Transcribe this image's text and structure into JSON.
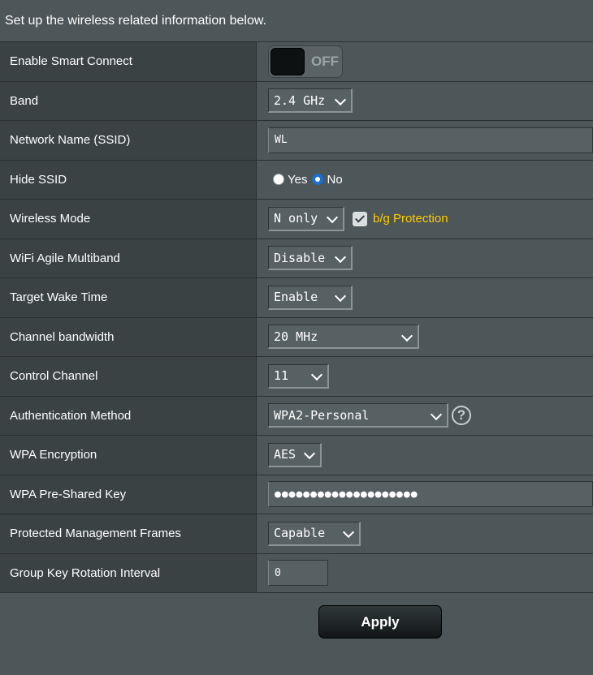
{
  "intro": "Set up the wireless related information below.",
  "colors": {
    "accent_blue": "#1a6fd0",
    "protection_yellow": "#ffcc00",
    "panel": "#4d5659",
    "label_bg": "#3a4244"
  },
  "rows": {
    "smart_connect": {
      "label": "Enable Smart Connect",
      "state": "OFF"
    },
    "band": {
      "label": "Band",
      "value": "2.4 GHz"
    },
    "ssid": {
      "label": "Network Name (SSID)",
      "value": "WL"
    },
    "hide_ssid": {
      "label": "Hide SSID",
      "yes": "Yes",
      "no": "No",
      "selected": "No"
    },
    "wireless_mode": {
      "label": "Wireless Mode",
      "value": "N only",
      "protection_label": "b/g Protection",
      "protection_checked": true
    },
    "agile_multiband": {
      "label": "WiFi Agile Multiband",
      "value": "Disable"
    },
    "target_wake_time": {
      "label": "Target Wake Time",
      "value": "Enable"
    },
    "channel_bandwidth": {
      "label": "Channel bandwidth",
      "value": "20 MHz"
    },
    "control_channel": {
      "label": "Control Channel",
      "value": "11"
    },
    "auth_method": {
      "label": "Authentication Method",
      "value": "WPA2-Personal",
      "help_icon": "help-icon",
      "help_glyph": "?"
    },
    "wpa_encryption": {
      "label": "WPA Encryption",
      "value": "AES"
    },
    "psk": {
      "label": "WPA Pre-Shared Key",
      "value": "●●●●●●●●●●●●●●●●●●●●"
    },
    "pmf": {
      "label": "Protected Management Frames",
      "value": "Capable"
    },
    "group_key": {
      "label": "Group Key Rotation Interval",
      "value": "0"
    }
  },
  "apply_label": "Apply"
}
